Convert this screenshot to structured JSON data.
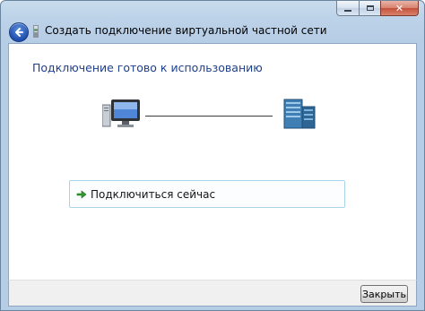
{
  "window": {
    "title": "Создать подключение виртуальной частной сети",
    "caption_buttons": [
      "minimize-icon",
      "maximize-icon",
      "close-icon"
    ],
    "accent_color": "#1e3f8c"
  },
  "main": {
    "heading": "Подключение готово к использованию",
    "left_icon": "computer-icon",
    "right_icon": "server-icon",
    "connect_option": {
      "icon": "green-arrow-icon",
      "label": "Подключиться сейчас"
    }
  },
  "footer": {
    "close_label": "Закрыть"
  }
}
